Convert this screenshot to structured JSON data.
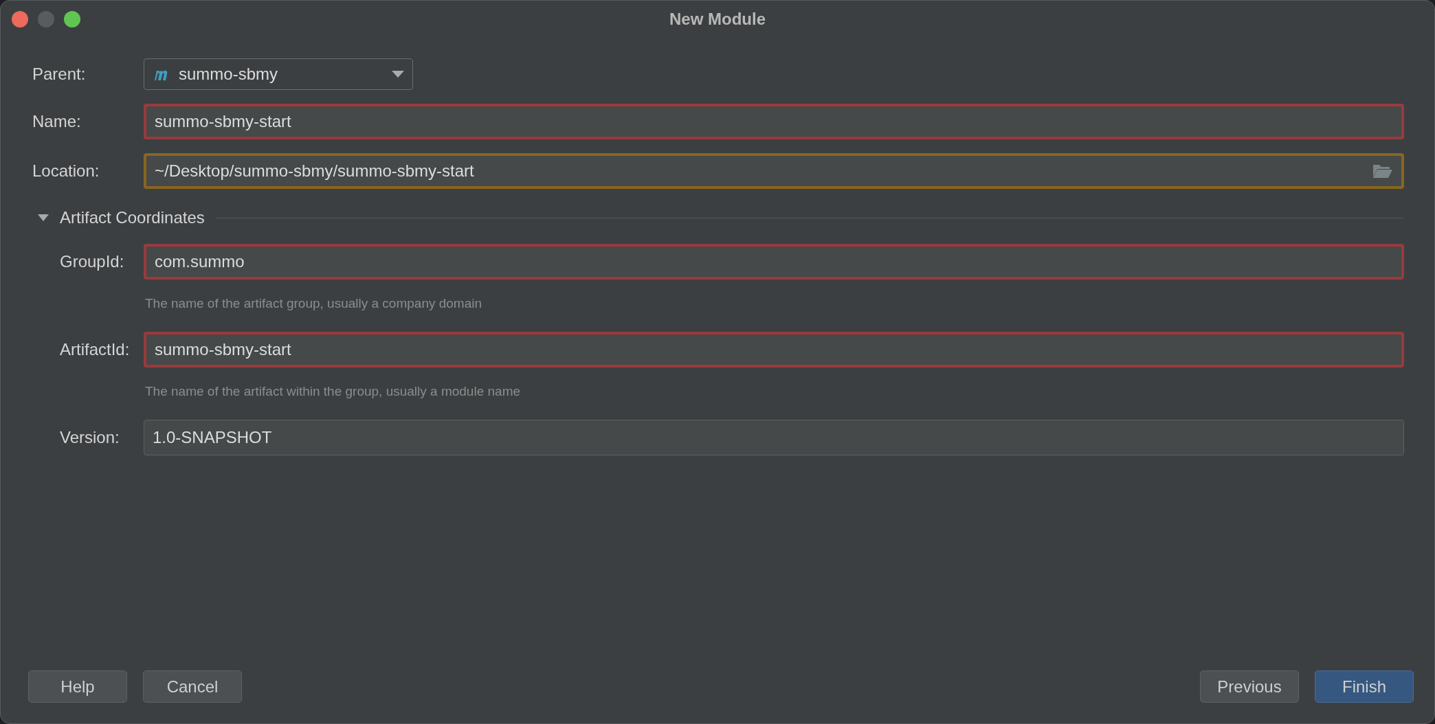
{
  "window": {
    "title": "New Module"
  },
  "fields": [
    {
      "label": "Parent:",
      "kind": "dropdown",
      "value": "summo-sbmy"
    },
    {
      "label": "Name:",
      "kind": "text",
      "value": "summo-sbmy-start",
      "error": true
    },
    {
      "label": "Location:",
      "kind": "path",
      "value": "~/Desktop/summo-sbmy/summo-sbmy-start",
      "warning": true
    }
  ],
  "section": {
    "title": "Artifact Coordinates",
    "expanded": true,
    "fields": [
      {
        "label": "GroupId:",
        "value": "com.summo",
        "hint": "The name of the artifact group, usually a company domain",
        "error": true
      },
      {
        "label": "ArtifactId:",
        "value": "summo-sbmy-start",
        "hint": "The name of the artifact within the group, usually a module name",
        "error": true
      },
      {
        "label": "Version:",
        "value": "1.0-SNAPSHOT",
        "error": false
      }
    ]
  },
  "buttons_left": [
    {
      "label": "Help",
      "default": false
    },
    {
      "label": "Cancel",
      "default": false
    }
  ],
  "buttons_right": [
    {
      "label": "Previous",
      "default": false
    },
    {
      "label": "Finish",
      "default": true
    }
  ]
}
